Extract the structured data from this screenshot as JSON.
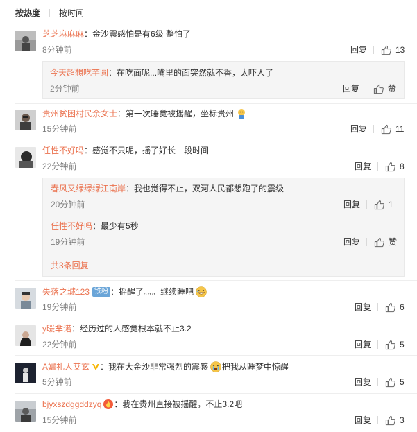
{
  "sort": {
    "hot": "按热度",
    "time": "按时间"
  },
  "common": {
    "reply": "回复",
    "colon": "："
  },
  "comments": [
    {
      "user": "芝芝麻麻麻",
      "text": "金沙震感怕是有6级 整怕了",
      "time": "8分钟前",
      "likes": "13"
    },
    {
      "user": "贵州贫困村民余女士",
      "text": "第一次睡觉被摇醒，坐标贵州",
      "time": "15分钟前",
      "likes": "11"
    },
    {
      "user": "任性不好吗",
      "text": "感觉不只呢，摇了好长一段时间",
      "time": "22分钟前",
      "likes": "8"
    },
    {
      "user": "失落之城123",
      "badge": "铁粉",
      "text": "摇醒了。。。继续睡吧",
      "time": "19分钟前",
      "likes": "6"
    },
    {
      "user": "y暖芈诺",
      "text": "经历过的人感觉根本就不止3.2",
      "time": "22分钟前",
      "likes": "5"
    },
    {
      "user": "A嫿礼人艾玄",
      "text_before": "我在大金沙非常强烈的震感",
      "text_after": "把我从睡梦中惊醒",
      "time": "5分钟前",
      "likes": "5"
    },
    {
      "user": "bjyxszdggddzyq",
      "text": "我在贵州直接被摇醒，不止3.2吧",
      "time": "15分钟前",
      "likes": "3"
    }
  ],
  "subs": [
    {
      "user": "今天超想吃芋圆",
      "text": "在吃面呢...嘴里的面突然就不香，太吓人了",
      "time": "2分钟前",
      "likes": "赞"
    },
    {
      "user": "春风又绿绿绿江南岸",
      "text": "我也觉得不止，双河人民都想跑了的震级",
      "time": "20分钟前",
      "likes": "1"
    },
    {
      "user": "任性不好吗",
      "text": "最少有5秒",
      "time": "19分钟前",
      "likes": "赞"
    }
  ],
  "more_replies": "共3条回复",
  "colors": {
    "username": "#eb7350",
    "text": "#333333",
    "time": "#808080",
    "badge": "#6aa5d8"
  }
}
